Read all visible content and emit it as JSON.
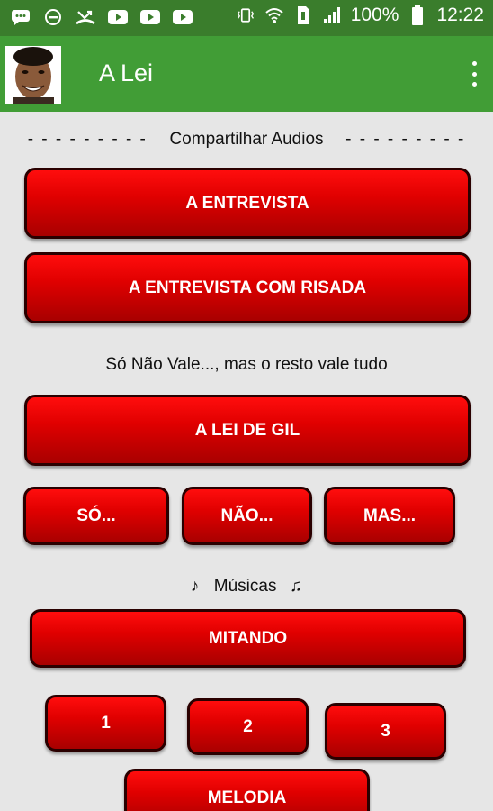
{
  "status_bar": {
    "left_icons": [
      "chat-icon",
      "do-not-disturb-icon",
      "missed-call-icon",
      "youtube-icon",
      "youtube-icon",
      "youtube-icon"
    ],
    "right_icons": [
      "vibrate-icon",
      "wifi-icon",
      "sim-icon",
      "signal-icon",
      "battery-icon"
    ],
    "battery_percent": "100%",
    "time": "12:22"
  },
  "app_bar": {
    "title": "A Lei",
    "avatar": "avatar",
    "menu_icon": "overflow-menu-icon"
  },
  "sections": {
    "share_left_dashes": "- - - - - - - - -",
    "share_title": "Compartilhar Audios",
    "share_right_dashes": "- - - - - - - - -",
    "rule_caption": "Só Não Vale..., mas o resto vale tudo",
    "music_note_left": "♪",
    "music_title": "Músicas",
    "music_note_right": "♫"
  },
  "buttons": {
    "entrevista": "A ENTREVISTA",
    "entrevista_risada": "A ENTREVISTA COM RISADA",
    "lei_de_gil": "A LEI DE GIL",
    "so": "SÓ...",
    "nao": "NÃO...",
    "mas": "MAS...",
    "mitando": "MITANDO",
    "one": "1",
    "two": "2",
    "three": "3",
    "melodia": "MELODIA"
  },
  "colors": {
    "status_bar": "#3a7d2c",
    "app_bar": "#419d36",
    "button_red": "#e00000",
    "background": "#e6e6e6"
  }
}
